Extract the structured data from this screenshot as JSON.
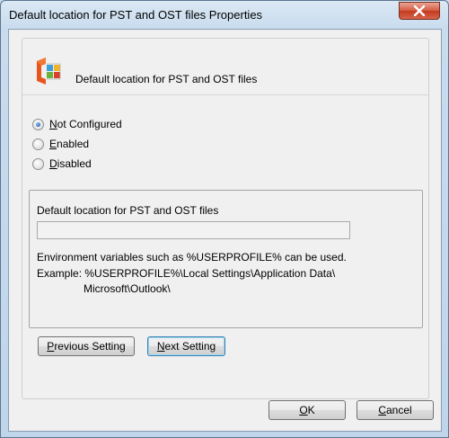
{
  "window": {
    "title": "Default location for PST and OST files Properties"
  },
  "header": {
    "icon": "office-logo-icon",
    "title": "Default location for PST and OST files"
  },
  "radios": [
    {
      "label": "Not Configured",
      "accel": "N",
      "rest": "ot Configured",
      "checked": true
    },
    {
      "label": "Enabled",
      "accel": "E",
      "rest": "nabled",
      "checked": false
    },
    {
      "label": "Disabled",
      "accel": "D",
      "rest": "isabled",
      "checked": false
    }
  ],
  "options": {
    "field_label": "Default location for PST and OST files",
    "field_value": "",
    "help_line1": "Environment variables such as %USERPROFILE% can be used.",
    "help_line2": "Example:  %USERPROFILE%\\Local Settings\\Application Data\\",
    "help_line3": "Microsoft\\Outlook\\"
  },
  "nav": {
    "previous": {
      "label": "Previous Setting",
      "accel": "P",
      "rest": "revious Setting"
    },
    "next": {
      "label": "Next Setting",
      "accel": "N",
      "rest": "ext Setting"
    }
  },
  "footer": {
    "ok": {
      "label": "OK",
      "accel": "O",
      "rest": "K"
    },
    "cancel": {
      "label": "Cancel",
      "accel": "C",
      "rest": "ancel"
    }
  },
  "colors": {
    "title_bar": "#c9dcee",
    "close_button": "#c23b1f",
    "dialog_bg": "#f0f0f0",
    "radio_selected": "#2a6bc4"
  }
}
